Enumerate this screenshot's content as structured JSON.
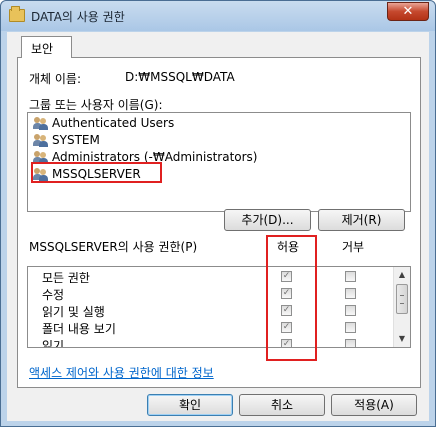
{
  "window": {
    "title": "DATA의 사용 권한",
    "close_glyph": "✕"
  },
  "tabs": [
    {
      "label": "보안",
      "active": true
    }
  ],
  "object": {
    "label": "개체 이름:",
    "value": "D:₩MSSQL₩DATA"
  },
  "groups": {
    "label": "그룹 또는 사용자 이름(G):",
    "items": [
      {
        "label": "Authenticated Users",
        "icon": "user-group-icon"
      },
      {
        "label": "SYSTEM",
        "icon": "user-group-icon"
      },
      {
        "label": "Administrators (-₩Administrators)",
        "icon": "user-group-icon"
      },
      {
        "label": "MSSQLSERVER",
        "icon": "user-group-icon",
        "highlighted": true
      }
    ]
  },
  "buttons": {
    "add": "추가(D)...",
    "remove": "제거(R)",
    "ok": "확인",
    "cancel": "취소",
    "apply": "적용(A)"
  },
  "permissions": {
    "label": "MSSQLSERVER의 사용 권한(P)",
    "allow_header": "허용",
    "deny_header": "거부",
    "rows": [
      {
        "name": "모든 권한",
        "allow": true,
        "deny": false
      },
      {
        "name": "수정",
        "allow": true,
        "deny": false
      },
      {
        "name": "읽기 및 실행",
        "allow": true,
        "deny": false
      },
      {
        "name": "폴더 내용 보기",
        "allow": true,
        "deny": false
      },
      {
        "name": "읽기",
        "allow": true,
        "deny": false
      }
    ]
  },
  "info_link": "액세스 제어와 사용 권한에 대한 정보",
  "colors": {
    "highlight": "#e02020",
    "link": "#0066cc",
    "titlebar": "#bcd3ea"
  }
}
